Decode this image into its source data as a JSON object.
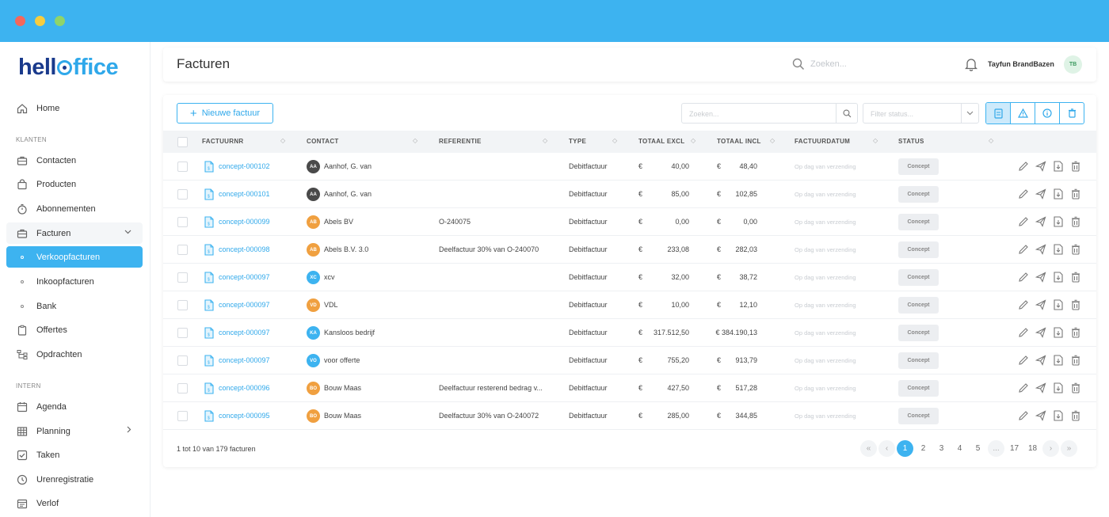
{
  "window": {
    "colors": {
      "titlebar": "#3db3f0",
      "accent": "#3db3f0"
    }
  },
  "sidebar": {
    "logo": {
      "part1": "hell",
      "part2": "ffice"
    },
    "home": "Home",
    "section_klanten": "KLANTEN",
    "items_klanten": [
      "Contacten",
      "Producten",
      "Abonnementen",
      "Facturen"
    ],
    "sub_facturen": [
      "Verkoopfacturen",
      "Inkoopfacturen",
      "Bank"
    ],
    "items_more": [
      "Offertes",
      "Opdrachten"
    ],
    "section_intern": "INTERN",
    "items_intern": [
      "Agenda",
      "Planning",
      "Taken",
      "Urenregistratie",
      "Verlof"
    ]
  },
  "topbar": {
    "title": "Facturen",
    "search_placeholder": "Zoeken...",
    "user_name": "Tayfun BrandBazen",
    "user_initials": "TB"
  },
  "toolbar": {
    "new_invoice": "Nieuwe factuur",
    "search_placeholder": "Zoeken...",
    "filter_placeholder": "Filter status..."
  },
  "table": {
    "columns": [
      "FACTUURNR",
      "CONTACT",
      "REFERENTIE",
      "TYPE",
      "TOTAAL EXCL",
      "TOTAAL INCL",
      "FACTUURDATUM",
      "STATUS"
    ],
    "currency": "€",
    "rows": [
      {
        "nr": "concept-000102",
        "initials": "AA",
        "color": "#4a4a4a",
        "contact": "Aanhof, G. van",
        "ref": "",
        "type": "Debitfactuur",
        "excl": "40,00",
        "incl": "48,40",
        "date": "Op dag van verzending",
        "status": "Concept"
      },
      {
        "nr": "concept-000101",
        "initials": "AA",
        "color": "#4a4a4a",
        "contact": "Aanhof, G. van",
        "ref": "",
        "type": "Debitfactuur",
        "excl": "85,00",
        "incl": "102,85",
        "date": "Op dag van verzending",
        "status": "Concept"
      },
      {
        "nr": "concept-000099",
        "initials": "AB",
        "color": "#f0a040",
        "contact": "Abels BV",
        "ref": "O-240075",
        "type": "Debitfactuur",
        "excl": "0,00",
        "incl": "0,00",
        "date": "Op dag van verzending",
        "status": "Concept"
      },
      {
        "nr": "concept-000098",
        "initials": "AB",
        "color": "#f0a040",
        "contact": "Abels B.V. 3.0",
        "ref": "Deelfactuur 30% van O-240070",
        "type": "Debitfactuur",
        "excl": "233,08",
        "incl": "282,03",
        "date": "Op dag van verzending",
        "status": "Concept"
      },
      {
        "nr": "concept-000097",
        "initials": "XC",
        "color": "#3db3f0",
        "contact": "xcv",
        "ref": "",
        "type": "Debitfactuur",
        "excl": "32,00",
        "incl": "38,72",
        "date": "Op dag van verzending",
        "status": "Concept"
      },
      {
        "nr": "concept-000097",
        "initials": "VD",
        "color": "#f0a040",
        "contact": "VDL",
        "ref": "",
        "type": "Debitfactuur",
        "excl": "10,00",
        "incl": "12,10",
        "date": "Op dag van verzending",
        "status": "Concept"
      },
      {
        "nr": "concept-000097",
        "initials": "KA",
        "color": "#3db3f0",
        "contact": "Kansloos bedrijf",
        "ref": "",
        "type": "Debitfactuur",
        "excl": "317.512,50",
        "incl": "€ 384.190,13",
        "date": "Op dag van verzending",
        "status": "Concept"
      },
      {
        "nr": "concept-000097",
        "initials": "VO",
        "color": "#3db3f0",
        "contact": "voor offerte",
        "ref": "",
        "type": "Debitfactuur",
        "excl": "755,20",
        "incl": "913,79",
        "date": "Op dag van verzending",
        "status": "Concept"
      },
      {
        "nr": "concept-000096",
        "initials": "BO",
        "color": "#f0a040",
        "contact": "Bouw Maas",
        "ref": "Deelfactuur resterend bedrag v...",
        "type": "Debitfactuur",
        "excl": "427,50",
        "incl": "517,28",
        "date": "Op dag van verzending",
        "status": "Concept"
      },
      {
        "nr": "concept-000095",
        "initials": "BO",
        "color": "#f0a040",
        "contact": "Bouw Maas",
        "ref": "Deelfactuur 30% van O-240072",
        "type": "Debitfactuur",
        "excl": "285,00",
        "incl": "344,85",
        "date": "Op dag van verzending",
        "status": "Concept"
      }
    ]
  },
  "footer": {
    "summary": "1 tot 10 van 179 facturen",
    "pages": [
      "1",
      "2",
      "3",
      "4",
      "5",
      "...",
      "17",
      "18"
    ],
    "current_page": "1"
  }
}
